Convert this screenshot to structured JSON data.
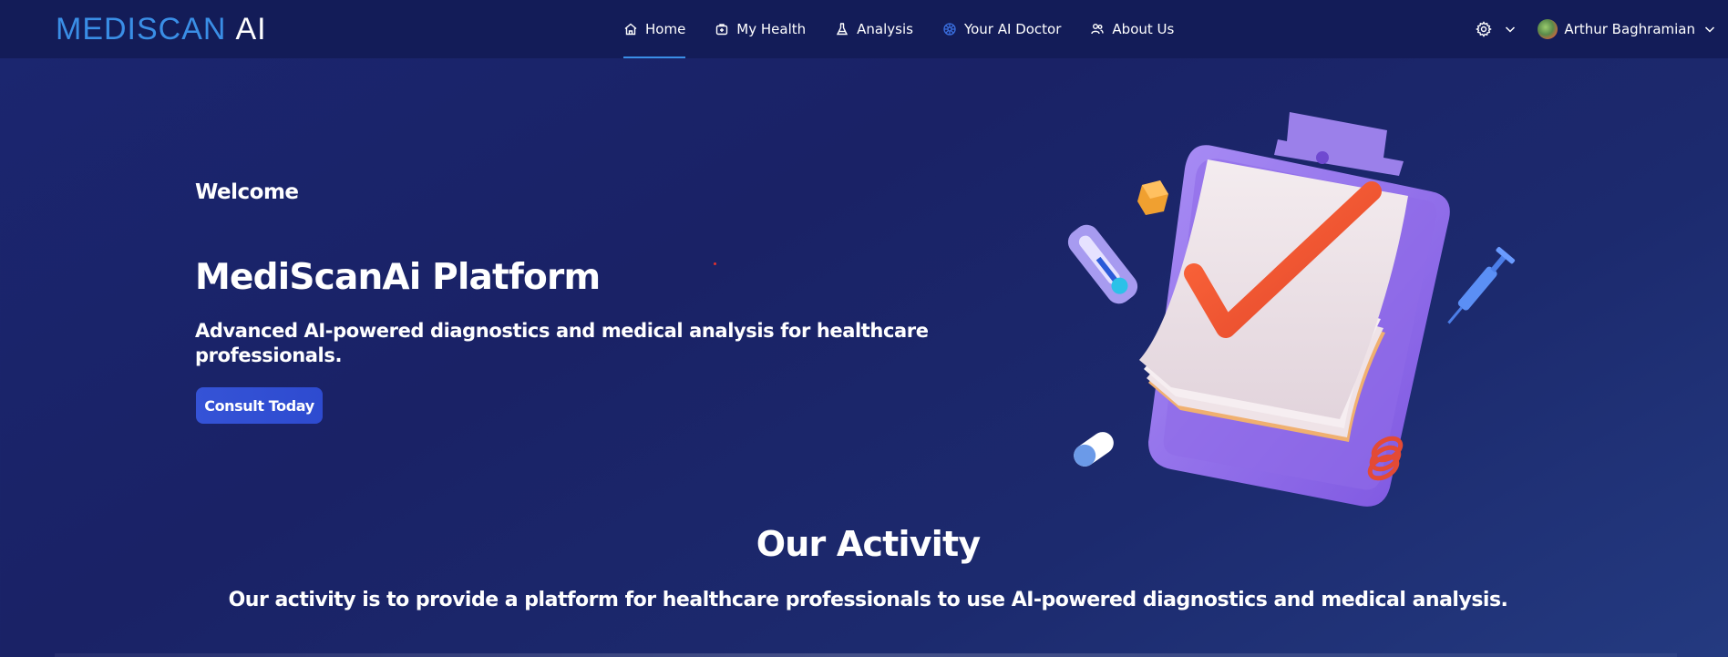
{
  "brand": {
    "part1": "MEDISCAN",
    "part2": "AI"
  },
  "nav": {
    "items": [
      {
        "label": "Home",
        "icon": "home-icon",
        "active": true
      },
      {
        "label": "My Health",
        "icon": "health-icon"
      },
      {
        "label": "Analysis",
        "icon": "flask-icon"
      },
      {
        "label": "Your AI Doctor",
        "icon": "ai-doctor-icon"
      },
      {
        "label": "About Us",
        "icon": "people-icon"
      }
    ],
    "settings_icon": "gear-icon",
    "user_name": "Arthur Baghramian"
  },
  "hero": {
    "welcome": "Welcome",
    "title": "MediScanAi Platform",
    "subtitle": "Advanced AI-powered diagnostics and medical analysis for healthcare professionals.",
    "cta_label": "Consult Today"
  },
  "activity": {
    "title": "Our Activity",
    "subtitle": "Our activity is to provide a platform for healthcare professionals to use AI-powered diagnostics and medical analysis."
  },
  "colors": {
    "accent": "#3a8ee6",
    "navbar_bg": "#131c58",
    "cta_bg": "#3553d6"
  }
}
